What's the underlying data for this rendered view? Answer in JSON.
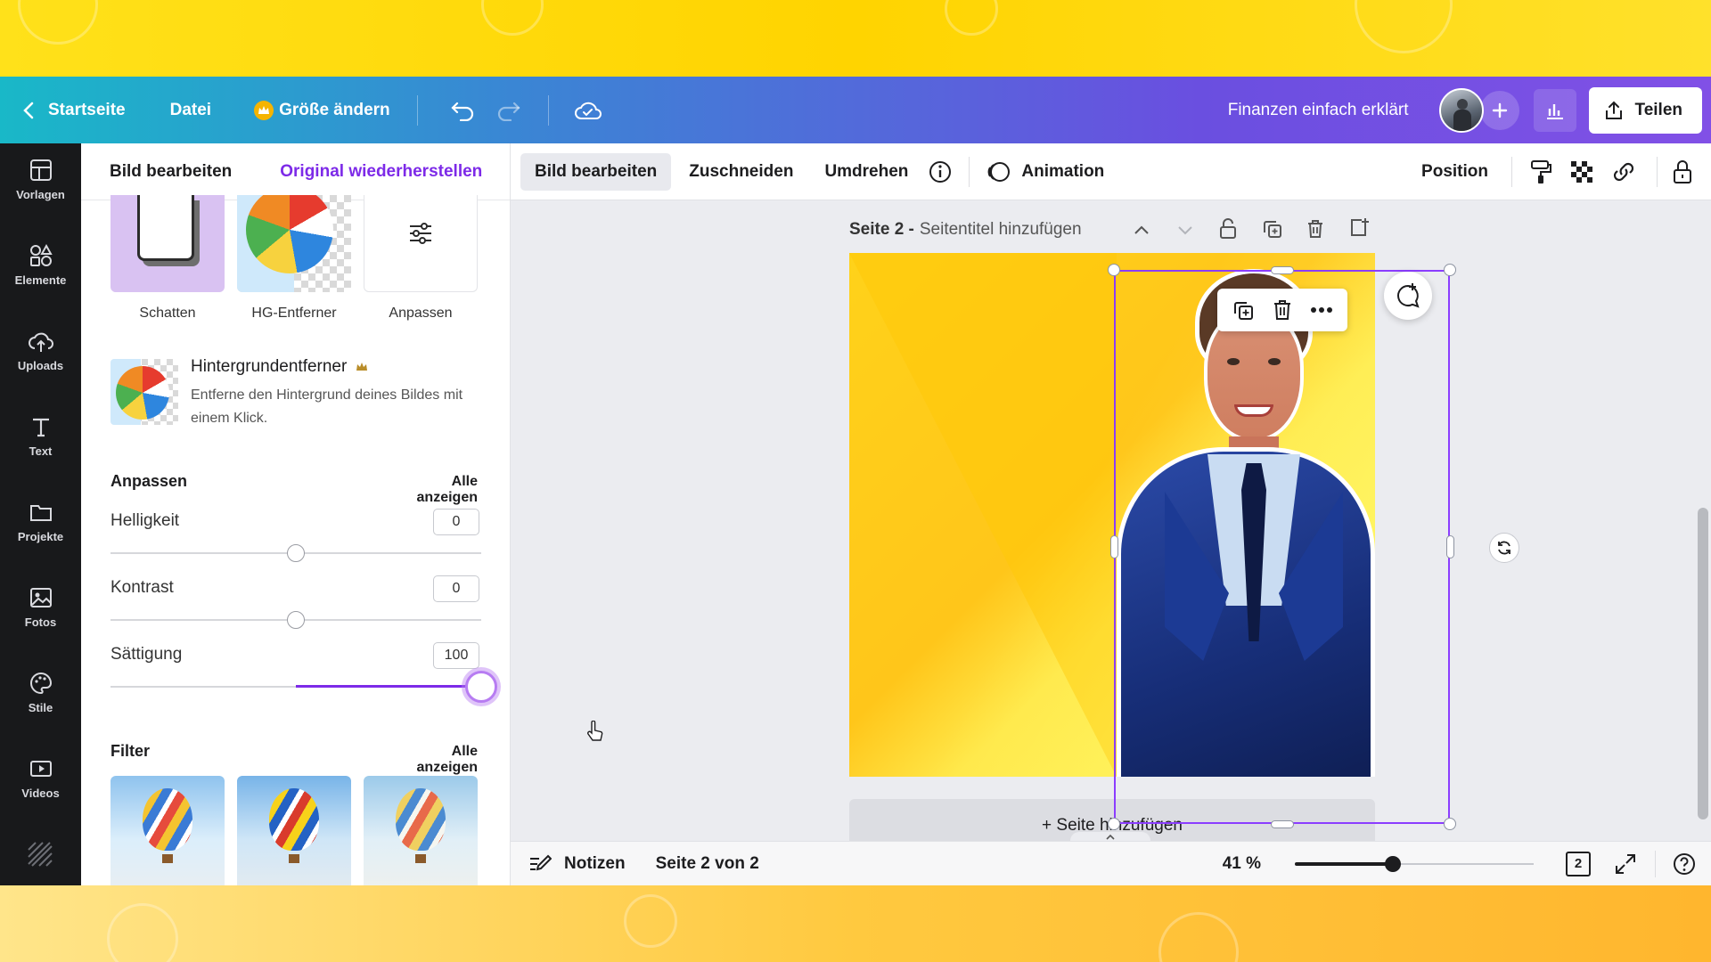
{
  "topbar": {
    "home_label": "Startseite",
    "file_label": "Datei",
    "resize_label": "Größe ändern",
    "design_title": "Finanzen einfach erklärt",
    "share_label": "Teilen"
  },
  "rail": {
    "items": [
      {
        "label": "Vorlagen",
        "icon": "template-icon"
      },
      {
        "label": "Elemente",
        "icon": "elements-icon"
      },
      {
        "label": "Uploads",
        "icon": "upload-cloud-icon"
      },
      {
        "label": "Text",
        "icon": "text-icon"
      },
      {
        "label": "Projekte",
        "icon": "folder-icon"
      },
      {
        "label": "Fotos",
        "icon": "photo-icon"
      },
      {
        "label": "Stile",
        "icon": "palette-icon"
      },
      {
        "label": "Videos",
        "icon": "video-icon"
      }
    ]
  },
  "panel": {
    "tab_edit": "Bild bearbeiten",
    "tab_restore": "Original wiederherstellen",
    "effects": [
      {
        "label": "Schatten"
      },
      {
        "label": "HG-Entferner"
      },
      {
        "label": "Anpassen"
      }
    ],
    "bg_remover": {
      "title": "Hintergrundentferner",
      "description": "Entferne den Hintergrund deines Bildes mit einem Klick."
    },
    "adjust": {
      "title": "Anpassen",
      "see_all": "Alle anzeigen",
      "sliders": [
        {
          "label": "Helligkeit",
          "value": "0",
          "min": -100,
          "max": 100,
          "level": 0
        },
        {
          "label": "Kontrast",
          "value": "0",
          "min": -100,
          "max": 100,
          "level": 0
        },
        {
          "label": "Sättigung",
          "value": "100",
          "min": -100,
          "max": 100,
          "level": 100
        }
      ]
    },
    "filter": {
      "title": "Filter",
      "see_all": "Alle anzeigen"
    }
  },
  "toolbar": {
    "edit_image": "Bild bearbeiten",
    "crop": "Zuschneiden",
    "flip": "Umdrehen",
    "animation": "Animation",
    "position": "Position"
  },
  "canvas": {
    "page_label": "Seite 2 -",
    "page_title_placeholder": "Seitentitel hinzufügen",
    "add_page": "+ Seite hinzufügen"
  },
  "footer": {
    "notes": "Notizen",
    "page_indicator": "Seite 2 von 2",
    "zoom": "41 %",
    "zoom_level": 41,
    "page_count": "2"
  },
  "colors": {
    "accent": "#8b3dff",
    "selection": "#8b3dff",
    "rail_bg": "#18191b"
  }
}
